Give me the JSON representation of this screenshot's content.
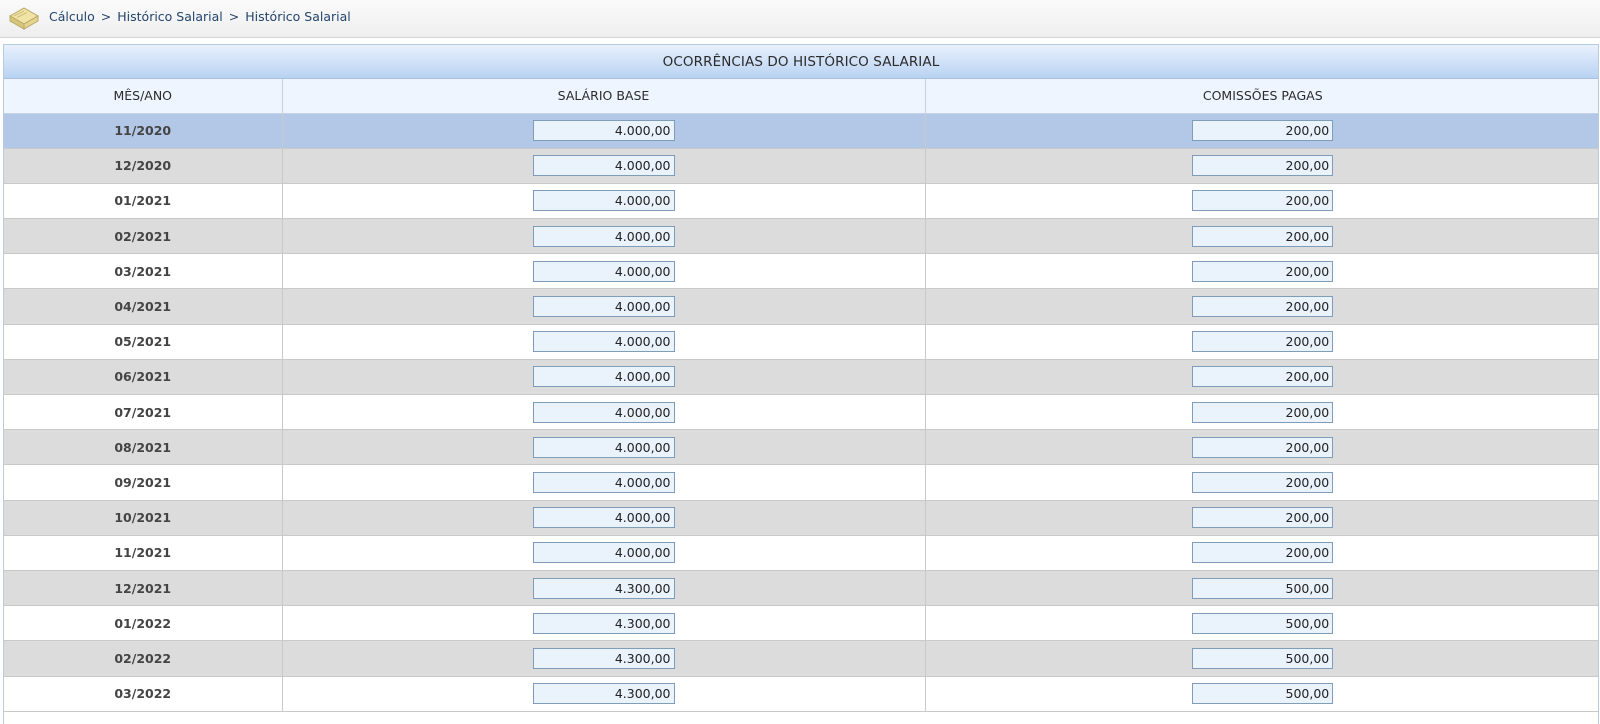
{
  "breadcrumb": [
    "Cálculo",
    "Histórico Salarial",
    "Histórico Salarial"
  ],
  "separator": ">",
  "panel": {
    "title": "OCORRÊNCIAS DO HISTÓRICO SALARIAL"
  },
  "table": {
    "columns": [
      "MÊS/ANO",
      "SALÁRIO BASE",
      "COMISSÕES PAGAS"
    ],
    "selected_row": 0,
    "rows": [
      {
        "month": "11/2020",
        "salario": "4.000,00",
        "comissoes": "200,00"
      },
      {
        "month": "12/2020",
        "salario": "4.000,00",
        "comissoes": "200,00"
      },
      {
        "month": "01/2021",
        "salario": "4.000,00",
        "comissoes": "200,00"
      },
      {
        "month": "02/2021",
        "salario": "4.000,00",
        "comissoes": "200,00"
      },
      {
        "month": "03/2021",
        "salario": "4.000,00",
        "comissoes": "200,00"
      },
      {
        "month": "04/2021",
        "salario": "4.000,00",
        "comissoes": "200,00"
      },
      {
        "month": "05/2021",
        "salario": "4.000,00",
        "comissoes": "200,00"
      },
      {
        "month": "06/2021",
        "salario": "4.000,00",
        "comissoes": "200,00"
      },
      {
        "month": "07/2021",
        "salario": "4.000,00",
        "comissoes": "200,00"
      },
      {
        "month": "08/2021",
        "salario": "4.000,00",
        "comissoes": "200,00"
      },
      {
        "month": "09/2021",
        "salario": "4.000,00",
        "comissoes": "200,00"
      },
      {
        "month": "10/2021",
        "salario": "4.000,00",
        "comissoes": "200,00"
      },
      {
        "month": "11/2021",
        "salario": "4.000,00",
        "comissoes": "200,00"
      },
      {
        "month": "12/2021",
        "salario": "4.300,00",
        "comissoes": "500,00"
      },
      {
        "month": "01/2022",
        "salario": "4.300,00",
        "comissoes": "500,00"
      },
      {
        "month": "02/2022",
        "salario": "4.300,00",
        "comissoes": "500,00"
      },
      {
        "month": "03/2022",
        "salario": "4.300,00",
        "comissoes": "500,00"
      }
    ]
  },
  "colors": {
    "selected_row": "#b3c7e6",
    "alt_row": "#dcdcdc",
    "input_bg": "#eaf2fc",
    "link": "#23456e"
  },
  "icons": {
    "logo": "book-icon"
  }
}
